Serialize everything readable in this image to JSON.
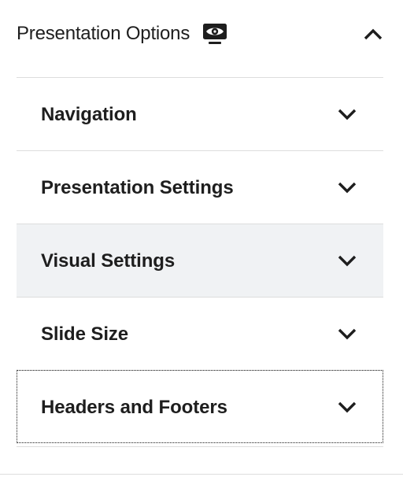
{
  "panel": {
    "title": "Presentation Options",
    "title_icon": "eye-icon",
    "toggle_icon": "chevron-up-icon",
    "expanded": true
  },
  "sections": [
    {
      "label": "Navigation",
      "icon": "chevron-down-icon",
      "state": "default"
    },
    {
      "label": "Presentation Settings",
      "icon": "chevron-down-icon",
      "state": "default"
    },
    {
      "label": "Visual Settings",
      "icon": "chevron-down-icon",
      "state": "hover"
    },
    {
      "label": "Slide Size",
      "icon": "chevron-down-icon",
      "state": "default"
    },
    {
      "label": "Headers and Footers",
      "icon": "chevron-down-icon",
      "state": "focused"
    }
  ],
  "colors": {
    "text": "#1e1e1e",
    "divider": "#dddddd",
    "hover_background": "#f0f2f4",
    "background": "#ffffff"
  }
}
